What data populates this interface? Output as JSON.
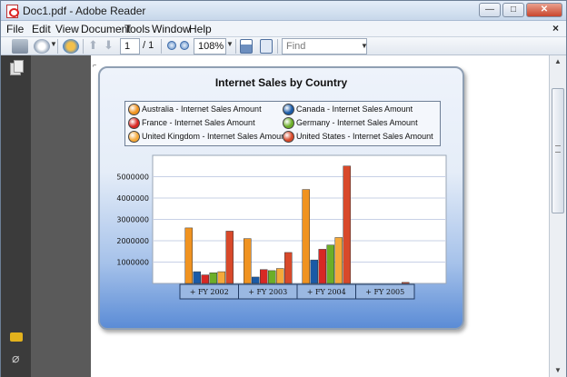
{
  "window": {
    "title": "Doc1.pdf - Adobe Reader",
    "min_label": "—",
    "max_label": "□",
    "close_label": "✕"
  },
  "menu": {
    "items": [
      "File",
      "Edit",
      "View",
      "Document",
      "Tools",
      "Window",
      "Help"
    ],
    "doc_close": "×"
  },
  "toolbar": {
    "page_current": "1",
    "page_total": "/ 1",
    "zoom": "108%",
    "find_placeholder": "Find"
  },
  "colors": {
    "australia": "#f09320",
    "canada": "#1a5aa6",
    "france": "#d72824",
    "germany": "#6cae28",
    "united_kingdom": "#f5a93a",
    "united_states": "#d8492a"
  },
  "chart_data": {
    "type": "bar",
    "title": "Internet Sales by Country",
    "categories": [
      "+ FY 2002",
      "+ FY 2003",
      "+ FY 2004",
      "+ FY 2005"
    ],
    "ylim": [
      0,
      6000000
    ],
    "yticks": [
      "1000000",
      "2000000",
      "3000000",
      "4000000",
      "5000000"
    ],
    "ytick_values": [
      1000000,
      2000000,
      3000000,
      4000000,
      5000000
    ],
    "grid": true,
    "legend_placement": "top",
    "series": [
      {
        "name": "Australia - Internet Sales Amount",
        "color": "#f09320",
        "values": [
          2600000,
          2100000,
          4400000,
          0
        ]
      },
      {
        "name": "Canada - Internet Sales Amount",
        "color": "#1a5aa6",
        "values": [
          550000,
          300000,
          1100000,
          0
        ]
      },
      {
        "name": "France - Internet Sales Amount",
        "color": "#d72824",
        "values": [
          400000,
          650000,
          1600000,
          0
        ]
      },
      {
        "name": "Germany - Internet Sales Amount",
        "color": "#6cae28",
        "values": [
          500000,
          600000,
          1800000,
          0
        ]
      },
      {
        "name": "United Kingdom - Internet Sales Amount",
        "color": "#f5a93a",
        "values": [
          550000,
          700000,
          2150000,
          0
        ]
      },
      {
        "name": "United States - Internet Sales Amount",
        "color": "#d8492a",
        "values": [
          2450000,
          1450000,
          5500000,
          50000
        ]
      }
    ]
  }
}
